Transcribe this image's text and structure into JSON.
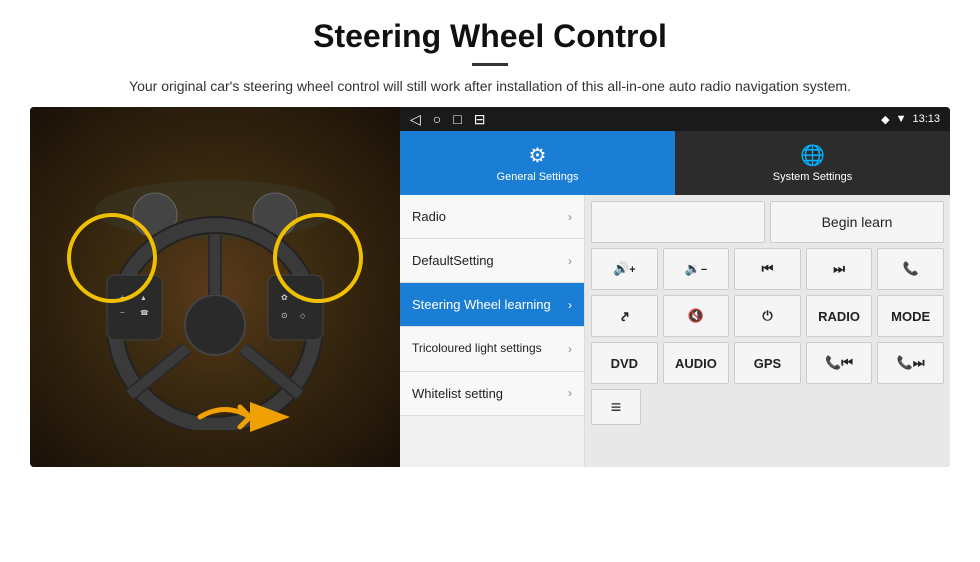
{
  "header": {
    "title": "Steering Wheel Control",
    "divider": true,
    "subtitle": "Your original car's steering wheel control will still work after installation of this all-in-one auto radio navigation system."
  },
  "statusBar": {
    "navItems": [
      "◁",
      "○",
      "□",
      "⊟"
    ],
    "rightIcons": [
      "♦",
      "▼"
    ],
    "time": "13:13"
  },
  "tabs": [
    {
      "id": "general",
      "label": "General Settings",
      "icon": "⚙",
      "active": true
    },
    {
      "id": "system",
      "label": "System Settings",
      "icon": "🌐",
      "active": false
    }
  ],
  "menuItems": [
    {
      "id": "radio",
      "label": "Radio",
      "active": false
    },
    {
      "id": "default",
      "label": "DefaultSetting",
      "active": false
    },
    {
      "id": "steering",
      "label": "Steering Wheel learning",
      "active": true
    },
    {
      "id": "tricoloured",
      "label": "Tricoloured light settings",
      "active": false
    },
    {
      "id": "whitelist",
      "label": "Whitelist setting",
      "active": false
    }
  ],
  "rightPanel": {
    "beginLearnLabel": "Begin learn",
    "buttonRows": [
      [
        {
          "id": "vol-up",
          "label": "🔊+",
          "type": "icon"
        },
        {
          "id": "vol-down",
          "label": "🔉−",
          "type": "icon"
        },
        {
          "id": "prev-track",
          "label": "⏮",
          "type": "icon"
        },
        {
          "id": "next-track",
          "label": "⏭",
          "type": "icon"
        },
        {
          "id": "call",
          "label": "📞",
          "type": "icon"
        }
      ],
      [
        {
          "id": "hang-up",
          "label": "↩",
          "type": "icon"
        },
        {
          "id": "mute",
          "label": "🔇x",
          "type": "icon"
        },
        {
          "id": "power",
          "label": "⏻",
          "type": "icon"
        },
        {
          "id": "radio-btn",
          "label": "RADIO",
          "type": "text"
        },
        {
          "id": "mode-btn",
          "label": "MODE",
          "type": "text"
        }
      ],
      [
        {
          "id": "dvd-btn",
          "label": "DVD",
          "type": "text"
        },
        {
          "id": "audio-btn",
          "label": "AUDIO",
          "type": "text"
        },
        {
          "id": "gps-btn",
          "label": "GPS",
          "type": "text"
        },
        {
          "id": "tel-prev",
          "label": "📞⏮",
          "type": "icon"
        },
        {
          "id": "tel-next",
          "label": "📞⏭",
          "type": "icon"
        }
      ]
    ],
    "bottomIcon": "≡"
  }
}
